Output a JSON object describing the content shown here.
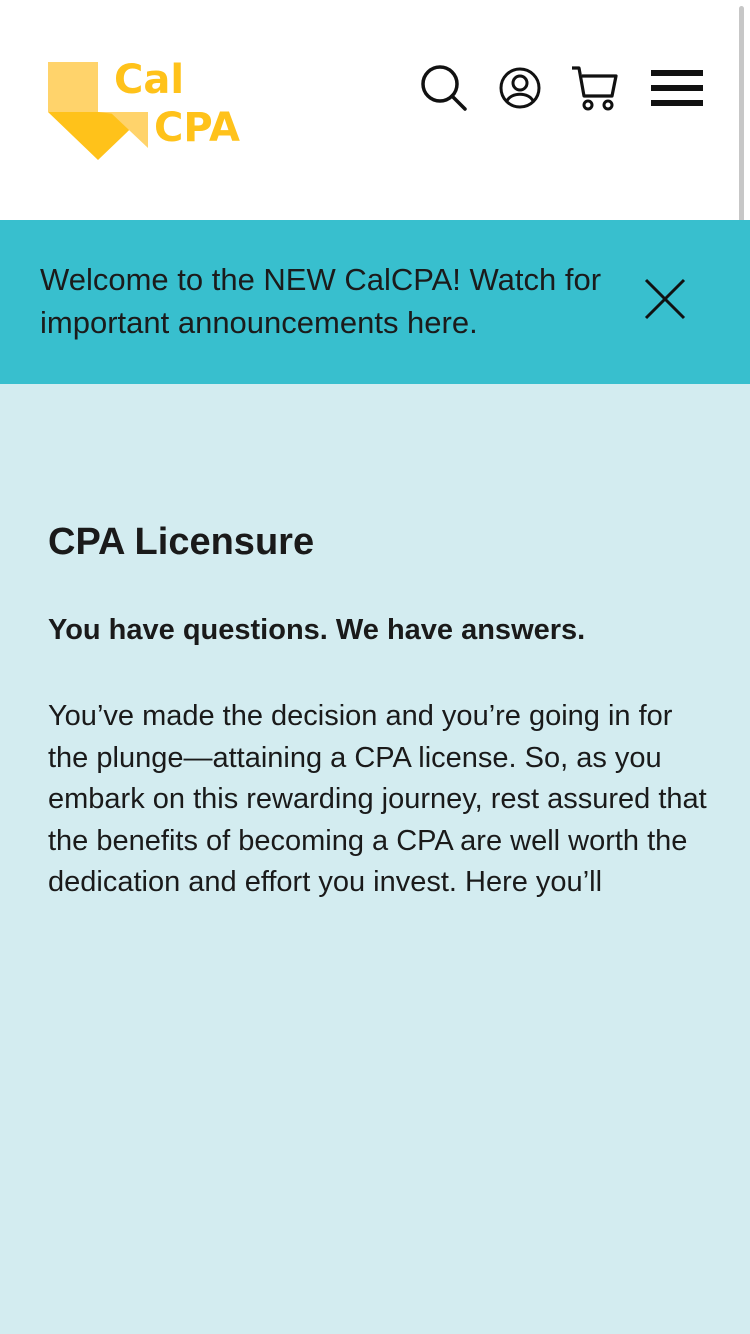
{
  "header": {
    "logo": {
      "line1": "Cal",
      "line2": "CPA",
      "primary_color": "#FFC21A",
      "light_color": "#FFD36B"
    },
    "icons": [
      "search-icon",
      "account-icon",
      "cart-icon",
      "menu-icon"
    ]
  },
  "banner": {
    "text": "Welcome to the NEW CalCPA! Watch for important announcements here.",
    "background": "#38BFCE",
    "close_icon": "close-icon"
  },
  "main": {
    "background": "#D3ECF0",
    "title": "CPA Licensure",
    "subheading": "You have questions. We have answers.",
    "body": "You’ve made the decision and you’re going in for the plunge—attaining a CPA license. So, as you embark on this rewarding journey, rest assured that the benefits of becoming a CPA are well worth the dedication and effort you invest. Here you’ll"
  }
}
